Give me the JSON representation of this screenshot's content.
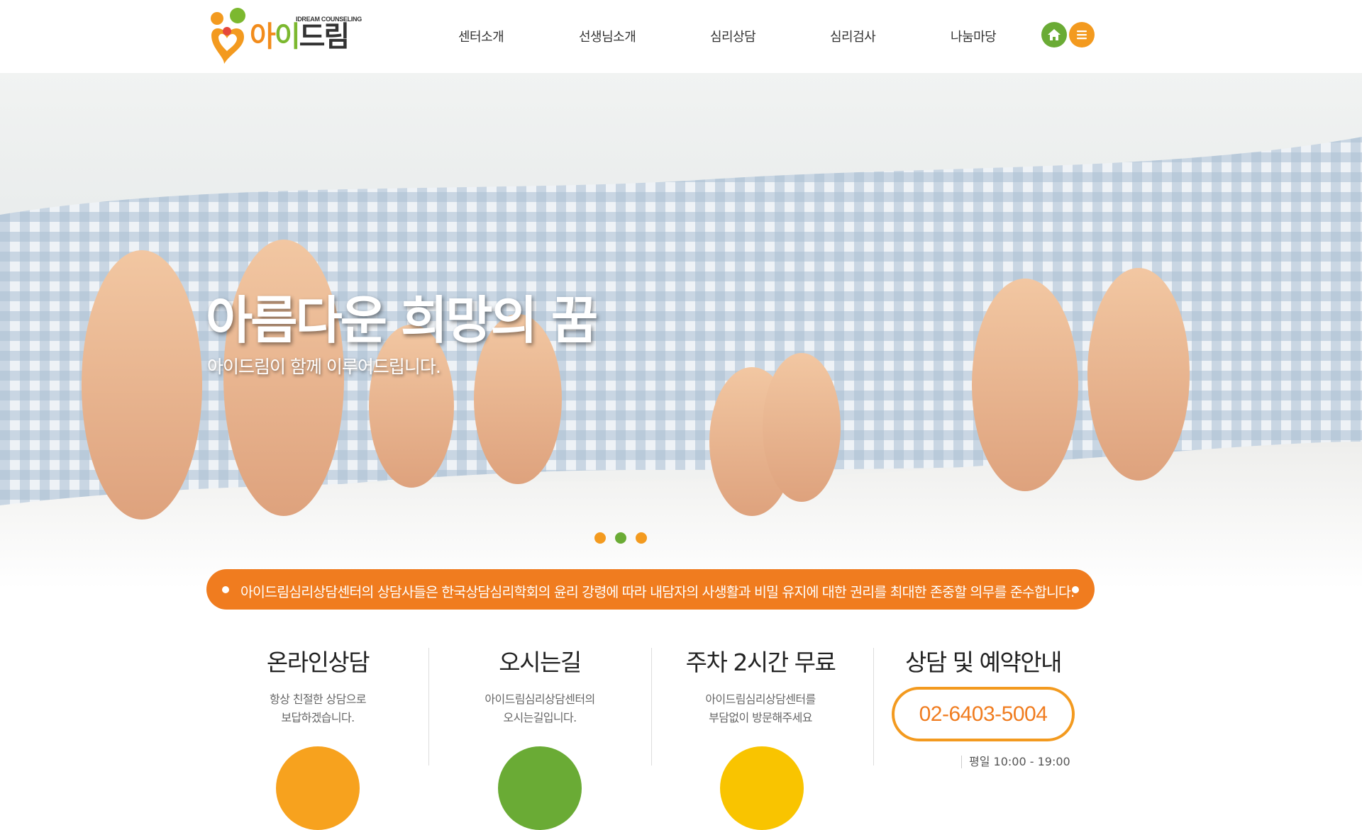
{
  "logo": {
    "brand_text": "아이드림",
    "sub_text": "IDREAM COUNSELING"
  },
  "nav": {
    "items": [
      {
        "label": "센터소개"
      },
      {
        "label": "선생님소개"
      },
      {
        "label": "심리상담"
      },
      {
        "label": "심리검사"
      },
      {
        "label": "나눔마당"
      }
    ],
    "home_icon": "home-icon",
    "menu_icon": "hamburger-menu-icon"
  },
  "hero": {
    "title": "아름다운 희망의 꿈",
    "subtitle": "아이드림이 함께 이루어드립니다.",
    "slides": [
      {
        "color": "#f39a1f"
      },
      {
        "color": "#6aab35"
      },
      {
        "color": "#f39a1f"
      }
    ]
  },
  "notice": {
    "text": "아이드림심리상담센터의 상담사들은 한국상담심리학회의 윤리 강령에 따라 내담자의 사생활과 비밀 유지에 대한 권리를 최대한 존중할 의무를 준수합니다."
  },
  "info": {
    "online": {
      "title": "온라인상담",
      "line1": "항상 친절한 상담으로",
      "line2": "보답하겠습니다.",
      "circle_color": "#f7a21e"
    },
    "directions": {
      "title": "오시는길",
      "line1": "아이드림심리상담센터의",
      "line2": "오시는길입니다.",
      "circle_color": "#6aab35"
    },
    "parking": {
      "title": "주차 2시간 무료",
      "line1": "아이드림심리상담센터를",
      "line2": "부담없이 방문해주세요",
      "circle_color": "#f9c400"
    },
    "reservation": {
      "title": "상담 및 예약안내",
      "phone": "02-6403-5004",
      "hours": "평일 10:00 - 19:00"
    }
  },
  "colors": {
    "accent_orange": "#f07c1f",
    "accent_green": "#6aab35",
    "accent_yellow": "#f9c400"
  }
}
